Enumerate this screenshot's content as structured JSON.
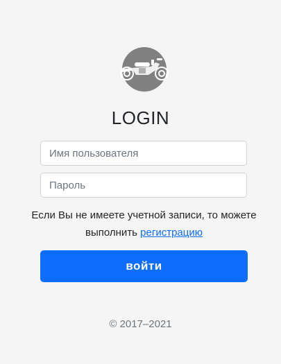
{
  "logo": {
    "icon": "motorcycle-icon",
    "color": "#808080"
  },
  "form": {
    "title": "LOGIN",
    "username": {
      "placeholder": "Имя пользователя",
      "value": ""
    },
    "password": {
      "placeholder": "Пароль",
      "value": ""
    },
    "note_text": "Если Вы не имеете учетной записи, то можете выполнить ",
    "register_link": "регистрацию",
    "submit_label": "войти"
  },
  "footer": {
    "copyright": "© 2017–2021"
  },
  "colors": {
    "accent": "#0d6efd",
    "background": "#f5f5f5",
    "muted": "#6c757d"
  }
}
